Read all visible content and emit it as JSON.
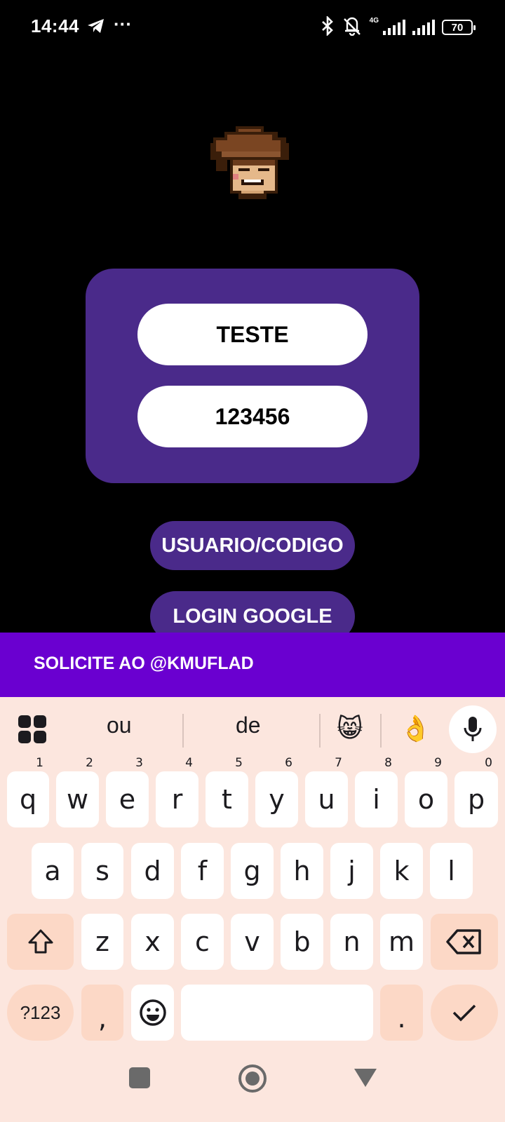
{
  "status_bar": {
    "time": "14:44",
    "network": "4G",
    "battery": "70"
  },
  "login": {
    "username_value": "TESTE",
    "password_value": "123456",
    "user_code_button": "USUARIO/CODIGO",
    "google_button": "LOGIN GOOGLE"
  },
  "banner": {
    "text": "SOLICITE AO @KMUFLAD"
  },
  "keyboard": {
    "suggestions": [
      "ou",
      "de"
    ],
    "emoji_suggestions": [
      "😸",
      "👌"
    ],
    "row1": [
      "q",
      "w",
      "e",
      "r",
      "t",
      "y",
      "u",
      "i",
      "o",
      "p"
    ],
    "row1_nums": [
      "1",
      "2",
      "3",
      "4",
      "5",
      "6",
      "7",
      "8",
      "9",
      "0"
    ],
    "row2": [
      "a",
      "s",
      "d",
      "f",
      "g",
      "h",
      "j",
      "k",
      "l"
    ],
    "row3": [
      "z",
      "x",
      "c",
      "v",
      "b",
      "n",
      "m"
    ],
    "symbols_key": "?123",
    "comma_key": ",",
    "period_key": "."
  },
  "colors": {
    "card": "#4a2a8a",
    "banner": "#6a00d0",
    "keyboard_bg": "#fce6de"
  }
}
